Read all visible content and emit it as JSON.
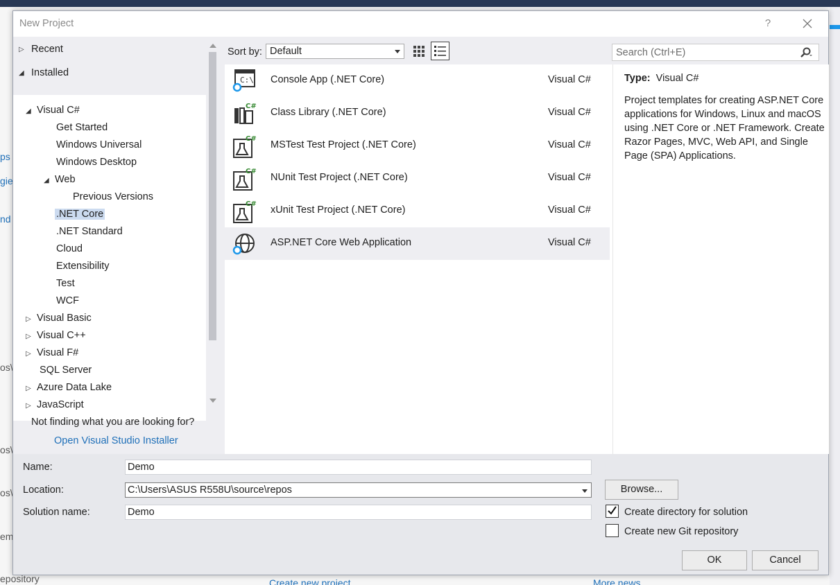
{
  "background": {
    "fragments": [
      "ps",
      "gies",
      "nd",
      "os\\",
      "os\\",
      "os\\",
      "em",
      "epository",
      "Create new project...",
      "More news..."
    ]
  },
  "dialog": {
    "title": "New Project",
    "help": "?",
    "close": "✕"
  },
  "left": {
    "recent": "Recent",
    "installed": "Installed",
    "tree": [
      {
        "label": "Visual C#",
        "arrow": "◢"
      },
      {
        "label": "Get Started",
        "arrow": ""
      },
      {
        "label": "Windows Universal",
        "arrow": ""
      },
      {
        "label": "Windows Desktop",
        "arrow": ""
      },
      {
        "label": "Web",
        "arrow": "◢"
      },
      {
        "label": "Previous Versions",
        "arrow": ""
      },
      {
        "label": ".NET Core",
        "arrow": ""
      },
      {
        "label": ".NET Standard",
        "arrow": ""
      },
      {
        "label": "Cloud",
        "arrow": ""
      },
      {
        "label": "Extensibility",
        "arrow": ""
      },
      {
        "label": "Test",
        "arrow": ""
      },
      {
        "label": "WCF",
        "arrow": ""
      },
      {
        "label": "Visual Basic",
        "arrow": "▷"
      },
      {
        "label": "Visual C++",
        "arrow": "▷"
      },
      {
        "label": "Visual F#",
        "arrow": "▷"
      },
      {
        "label": "SQL Server",
        "arrow": ""
      },
      {
        "label": "Azure Data Lake",
        "arrow": "▷"
      },
      {
        "label": "JavaScript",
        "arrow": "▷"
      }
    ],
    "not_finding": "Not finding what you are looking for?",
    "installer_link": "Open Visual Studio Installer"
  },
  "toolbar": {
    "sort_label": "Sort by:",
    "sort_value": "Default",
    "search_placeholder": "Search (Ctrl+E)"
  },
  "templates": [
    {
      "name": "Console App (.NET Core)",
      "lang": "Visual C#",
      "icon": "console-app-icon",
      "selected": false
    },
    {
      "name": "Class Library (.NET Core)",
      "lang": "Visual C#",
      "icon": "class-library-icon",
      "selected": false
    },
    {
      "name": "MSTest Test Project (.NET Core)",
      "lang": "Visual C#",
      "icon": "test-project-icon",
      "selected": false
    },
    {
      "name": "NUnit Test Project (.NET Core)",
      "lang": "Visual C#",
      "icon": "test-project-icon",
      "selected": false
    },
    {
      "name": "xUnit Test Project (.NET Core)",
      "lang": "Visual C#",
      "icon": "test-project-icon",
      "selected": false
    },
    {
      "name": "ASP.NET Core Web Application",
      "lang": "Visual C#",
      "icon": "web-app-icon",
      "selected": true
    }
  ],
  "info": {
    "type_label": "Type:",
    "type_value": "Visual C#",
    "description": "Project templates for creating ASP.NET Core applications for Windows, Linux and macOS using .NET Core or .NET Framework. Create Razor Pages, MVC, Web API, and Single Page (SPA) Applications."
  },
  "form": {
    "name_label": "Name:",
    "name_value": "Demo",
    "location_label": "Location:",
    "location_value": "C:\\Users\\ASUS R558U\\source\\repos",
    "solution_label": "Solution name:",
    "solution_value": "Demo",
    "browse": "Browse...",
    "create_dir_label": "Create directory for solution",
    "create_dir_checked": true,
    "git_label": "Create new Git repository",
    "git_checked": false,
    "ok": "OK",
    "cancel": "Cancel"
  },
  "colors": {
    "accent": "#1c97ea",
    "link": "#1e6fb8",
    "selection": "#ccdbf0",
    "csharp_green": "#388a34"
  }
}
